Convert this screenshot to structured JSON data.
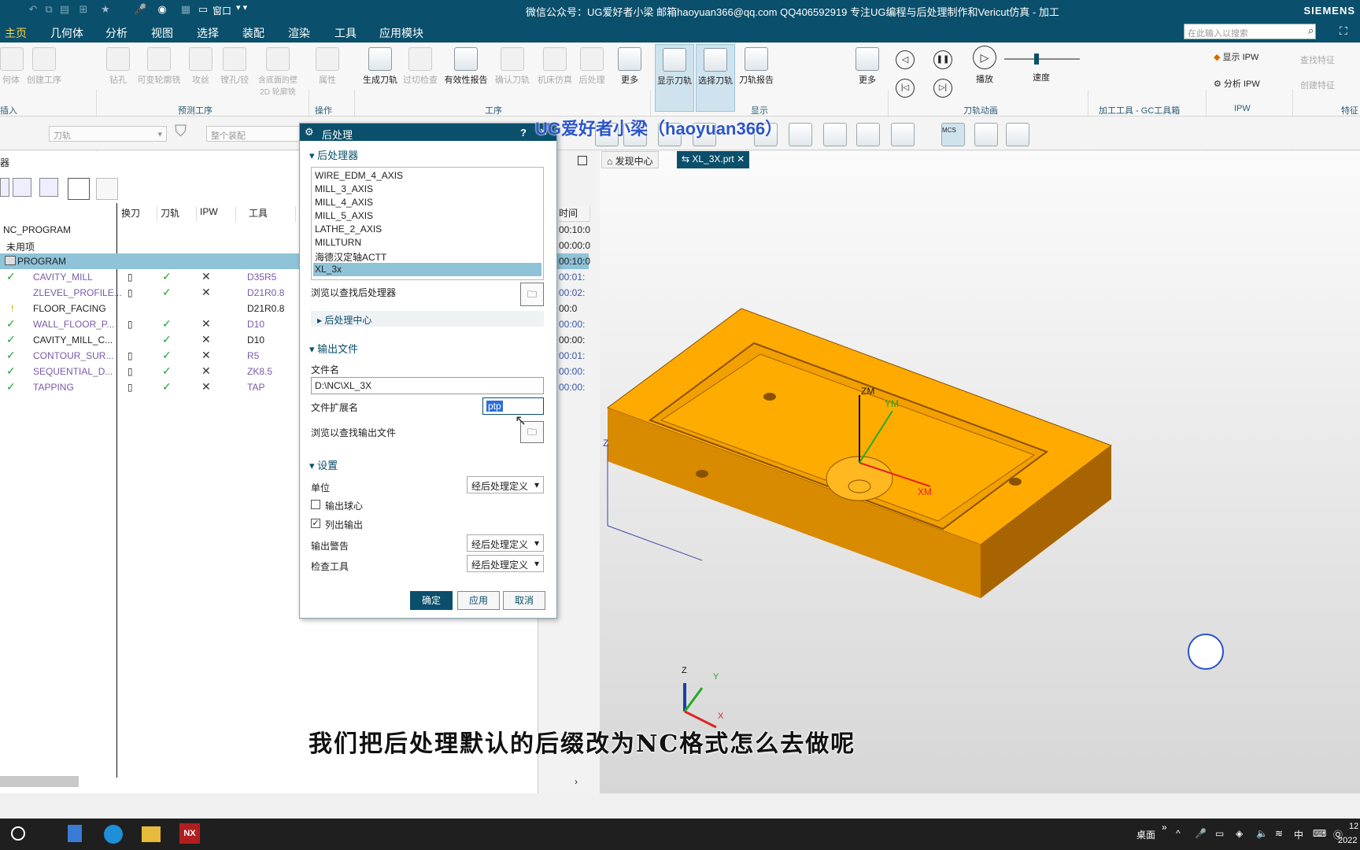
{
  "titlebar": {
    "title": "微信公众号：UG爱好者小梁  邮箱haoyuan366@qq.com  QQ406592919  专注UG编程与后处理制作和Vericut仿真 - 加工",
    "brand": "SIEMENS",
    "window_menu": "窗口"
  },
  "menu": [
    "主页",
    "几何体",
    "分析",
    "视图",
    "选择",
    "装配",
    "渲染",
    "工具",
    "应用模块"
  ],
  "search": {
    "placeholder": "在此输入以搜索"
  },
  "ribbon": {
    "groups": [
      "预测工序",
      "操作",
      "工序",
      "显示",
      "刀轨动画",
      "加工工具 - GC工具箱",
      "IPW",
      "特征"
    ],
    "buttons": {
      "b1": "何体",
      "b2": "创建工序",
      "b3": "钻孔",
      "b4": "可变轮廓铣",
      "b5": "攻丝",
      "b6": "镗孔/铰",
      "b7": "含底面的壁 2D 轮廓铣",
      "b8": "属性",
      "b9": "生成刀轨",
      "b10": "过切检查",
      "b11": "有效性报告",
      "b12": "确认刀轨",
      "b13": "机床仿真",
      "b14": "后处理",
      "b15": "更多",
      "b16": "显示刀轨",
      "b17": "选择刀轨",
      "b18": "刀轨报告",
      "b19": "更多",
      "b20": "播放",
      "b21": "速度",
      "b22": "显示 IPW",
      "b23": "分析 IPW",
      "b24": "查找特征",
      "b25": "创建特征",
      "b26": "插入"
    }
  },
  "toolbar2": {
    "filter1": "刀轨",
    "filter2": "整个装配"
  },
  "navigator": {
    "title": "器",
    "columns": [
      "换刀",
      "刀轨",
      "IPW",
      "工具",
      "时间"
    ],
    "rows": [
      {
        "name": "NC_PROGRAM",
        "tool": "",
        "time": "00:10:0"
      },
      {
        "name": "未用项",
        "tool": "",
        "time": "00:00:0"
      },
      {
        "name": "PROGRAM",
        "tool": "",
        "time": "00:10:0"
      },
      {
        "name": "CAVITY_MILL",
        "tool": "D35R5",
        "time": "00:01:"
      },
      {
        "name": "ZLEVEL_PROFILE...",
        "tool": "D21R0.8",
        "time": "00:02:"
      },
      {
        "name": "FLOOR_FACING",
        "tool": "D21R0.8",
        "time": "00:0"
      },
      {
        "name": "WALL_FLOOR_P...",
        "tool": "D10",
        "time": "00:00:"
      },
      {
        "name": "CAVITY_MILL_C...",
        "tool": "D10",
        "time": "00:00:"
      },
      {
        "name": "CONTOUR_SUR...",
        "tool": "R5",
        "time": "00:01:"
      },
      {
        "name": "SEQUENTIAL_D...",
        "tool": "ZK8.5",
        "time": "00:00:"
      },
      {
        "name": "TAPPING",
        "tool": "TAP",
        "time": "00:00:"
      }
    ]
  },
  "dialog": {
    "title": "后处理",
    "help": "?",
    "section_post": "后处理器",
    "postprocessors": [
      "WIRE_EDM_4_AXIS",
      "MILL_3_AXIS",
      "MILL_4_AXIS",
      "MILL_5_AXIS",
      "LATHE_2_AXIS",
      "MILLTURN",
      "海德汉定轴ACTT",
      "XL_3x"
    ],
    "selected_post": "XL_3x",
    "browse_post": "浏览以查找后处理器",
    "post_center": "后处理中心",
    "section_output": "输出文件",
    "filename_label": "文件名",
    "filename": "D:\\NC\\XL_3X",
    "ext_label": "文件扩展名",
    "ext_value": "ptp",
    "browse_output": "浏览以查找输出文件",
    "section_settings": "设置",
    "units_label": "单位",
    "units_value": "经后处理定义",
    "output_ball": "输出球心",
    "list_output": "列出输出",
    "output_ball_checked": false,
    "list_output_checked": true,
    "warn_label": "输出警告",
    "warn_value": "经后处理定义",
    "check_label": "检查工具",
    "check_value": "经后处理定义",
    "ok": "确定",
    "apply": "应用",
    "cancel": "取消"
  },
  "tabs": {
    "discover": "发现中心",
    "part": "XL_3X.prt"
  },
  "viewport": {
    "axis": {
      "zm": "ZM",
      "ym": "YM",
      "xm": "XM",
      "z": "Z",
      "y": "Y",
      "x": "X"
    },
    "part_color": "#ffa500",
    "logo": "UG爱好者小梁 haoyuan366"
  },
  "watermark": "UG爱好者小梁（haoyuan366）",
  "subtitle": "我们把后处理默认的后缀改为NC格式怎么去做呢",
  "taskbar": {
    "desktop": "桌面",
    "lang": "中",
    "clock_hour": "12",
    "clock_year": "2022"
  }
}
